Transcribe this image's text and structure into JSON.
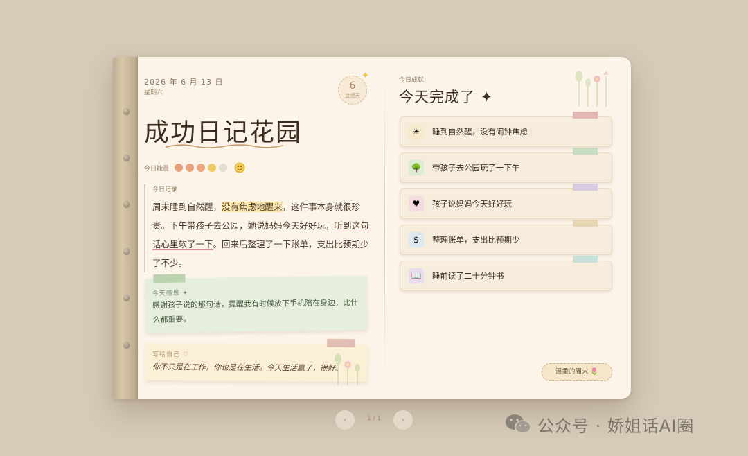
{
  "diary": {
    "date": "2026 年 6 月 13 日",
    "weekday": "星期六",
    "streak": {
      "count": "6",
      "label": "连续天"
    },
    "title": "成功日记花园",
    "energy": {
      "label": "今日能量",
      "levels": 4,
      "max": 5,
      "colors": [
        "#e39f7c",
        "#e6a07a",
        "#eda77e",
        "#edca62",
        "#e5dccd"
      ],
      "face_icon": "smiling-face-with-tear-icon"
    },
    "record": {
      "label": "今日记录",
      "text_1": "周末睡到自然醒，",
      "highlight": "没有焦虑地醒来",
      "text_2": "，这件事本身就很珍贵。下午带孩子去公园，她说妈妈今天好好玩，",
      "underline": "听到这句话心里软了一下",
      "text_3": "。回来后整理了一下账单，支出比预期少了不少。"
    },
    "gratitude": {
      "label": "今天感恩 ✦",
      "text": "感谢孩子说的那句话，提醒我有时候放下手机陪在身边，比什么都重要。"
    },
    "self_note": {
      "label": "写给自己 ♡",
      "text": "你不只是在工作，你也是在生活。今天生活赢了，很好。"
    }
  },
  "achievements": {
    "label": "今日成就",
    "title": "今天完成了 ✦",
    "items": [
      {
        "icon": "sun-icon",
        "text": "睡到自然醒，没有闹钟焦虑",
        "icon_bg": "#f6e9cc",
        "tape": "#e3b8b0"
      },
      {
        "icon": "tree-icon",
        "text": "带孩子去公园玩了一下午",
        "icon_bg": "#dcecd3",
        "tape": "#c7dcc0"
      },
      {
        "icon": "heart-icon",
        "text": "孩子说妈妈今天好好玩",
        "icon_bg": "#f5dbe0",
        "tape": "#d8cadf"
      },
      {
        "icon": "money-bag-icon",
        "text": "整理账单，支出比预期少",
        "icon_bg": "#dde9ee",
        "tape": "#e6d6b4"
      },
      {
        "icon": "book-icon",
        "text": "睡前读了二十分钟书",
        "icon_bg": "#e7ddee",
        "tape": "#c7e2d8"
      }
    ],
    "badge": "温柔的周末 🌷"
  },
  "pager": {
    "prev": "‹",
    "text": "1 / 1",
    "next": "›"
  },
  "watermark": "公众号 · 娇姐话AI圈"
}
